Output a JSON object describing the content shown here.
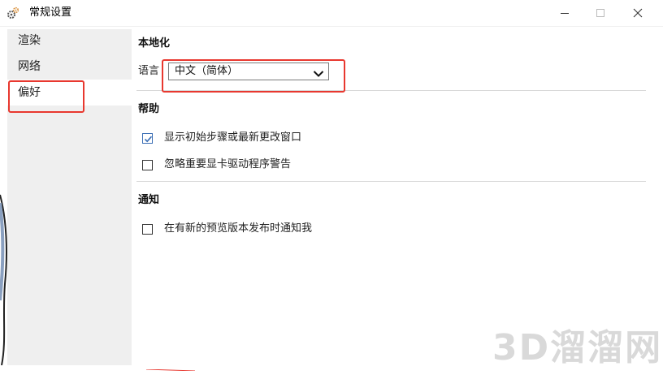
{
  "window": {
    "title": "常规设置",
    "icon": "gear-icon",
    "controls": [
      "minimize-icon",
      "maximize-icon",
      "close-icon"
    ]
  },
  "sidebar": {
    "items": [
      {
        "label": "渲染",
        "active": false
      },
      {
        "label": "网络",
        "active": false
      },
      {
        "label": "偏好",
        "active": true
      }
    ]
  },
  "localization": {
    "title": "本地化",
    "language_label": "语言",
    "language_value": "中文（简体）"
  },
  "help": {
    "title": "帮助",
    "options": [
      {
        "label": "显示初始步骤或最新更改窗口",
        "checked": true
      },
      {
        "label": "忽略重要显卡驱动程序警告",
        "checked": false
      }
    ]
  },
  "notify": {
    "title": "通知",
    "options": [
      {
        "label": "在有新的预览版本发布时通知我",
        "checked": false
      }
    ]
  },
  "annotation_color": "#e8382f",
  "checkbox_accent": "#3c6fb5",
  "watermark": "3D溜溜网"
}
